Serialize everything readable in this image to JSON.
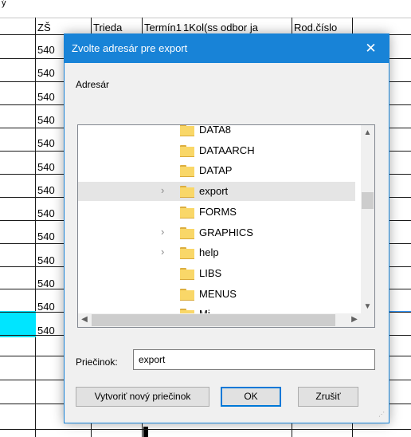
{
  "background_table": {
    "columns": [
      "ZŠ",
      "Trieda",
      "Termín1",
      "1Kol(ss odbor ja",
      "Rod.číslo"
    ],
    "row_prefix": "540",
    "row_count": 13
  },
  "dialog": {
    "title": "Zvolte adresár pre export",
    "close_icon": "close-icon",
    "directory_label": "Adresár",
    "folders": [
      {
        "name": "DATA8",
        "expandable": false,
        "selected": false
      },
      {
        "name": "DATAARCH",
        "expandable": false,
        "selected": false
      },
      {
        "name": "DATAP",
        "expandable": false,
        "selected": false
      },
      {
        "name": "export",
        "expandable": true,
        "selected": true
      },
      {
        "name": "FORMS",
        "expandable": false,
        "selected": false
      },
      {
        "name": "GRAPHICS",
        "expandable": true,
        "selected": false
      },
      {
        "name": "help",
        "expandable": true,
        "selected": false
      },
      {
        "name": "LIBS",
        "expandable": false,
        "selected": false
      },
      {
        "name": "MENUS",
        "expandable": false,
        "selected": false
      },
      {
        "name": "Mi",
        "expandable": false,
        "selected": false
      }
    ],
    "folder_label": "Priečinok:",
    "folder_value": "export",
    "buttons": {
      "new_folder": "Vytvoriť nový priečinok",
      "ok": "OK",
      "cancel": "Zrušiť"
    },
    "colors": {
      "title_bar": "#1883d7",
      "selection": "#e5e5e5",
      "folder": "#f9d768"
    }
  }
}
